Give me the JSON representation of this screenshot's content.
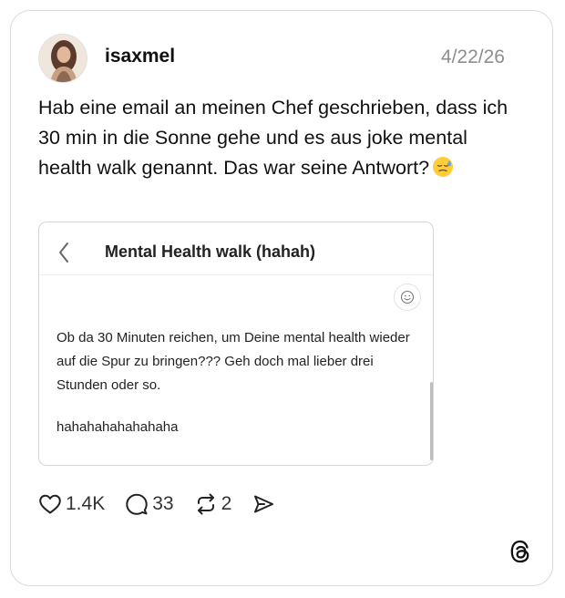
{
  "post": {
    "username": "isaxmel",
    "date": "4/22/26",
    "text": "Hab eine email an meinen Chef geschrieben, dass ich 30 min in die Sonne gehe und es aus joke mental health walk genannt. Das war seine Antwort?",
    "emoji": "sweat-smile-face"
  },
  "embed": {
    "title": "Mental Health walk (hahah)",
    "body": "Ob da 30 Minuten reichen, um Deine mental health wieder auf die Spur zu bringen??? Geh doch mal lieber drei Stunden oder so.",
    "laugh": "hahahahahahahaha"
  },
  "actions": {
    "likes": "1.4K",
    "replies": "33",
    "reposts": "2"
  },
  "icons": {
    "like": "heart-icon",
    "reply": "speech-bubble-icon",
    "repost": "repost-icon",
    "share": "send-icon",
    "brand": "threads-logo-icon",
    "back": "chevron-left-icon",
    "emoji_button": "smiley-icon"
  },
  "colors": {
    "text": "#111111",
    "muted": "#8e8e8e",
    "border": "#d9d9d9"
  }
}
